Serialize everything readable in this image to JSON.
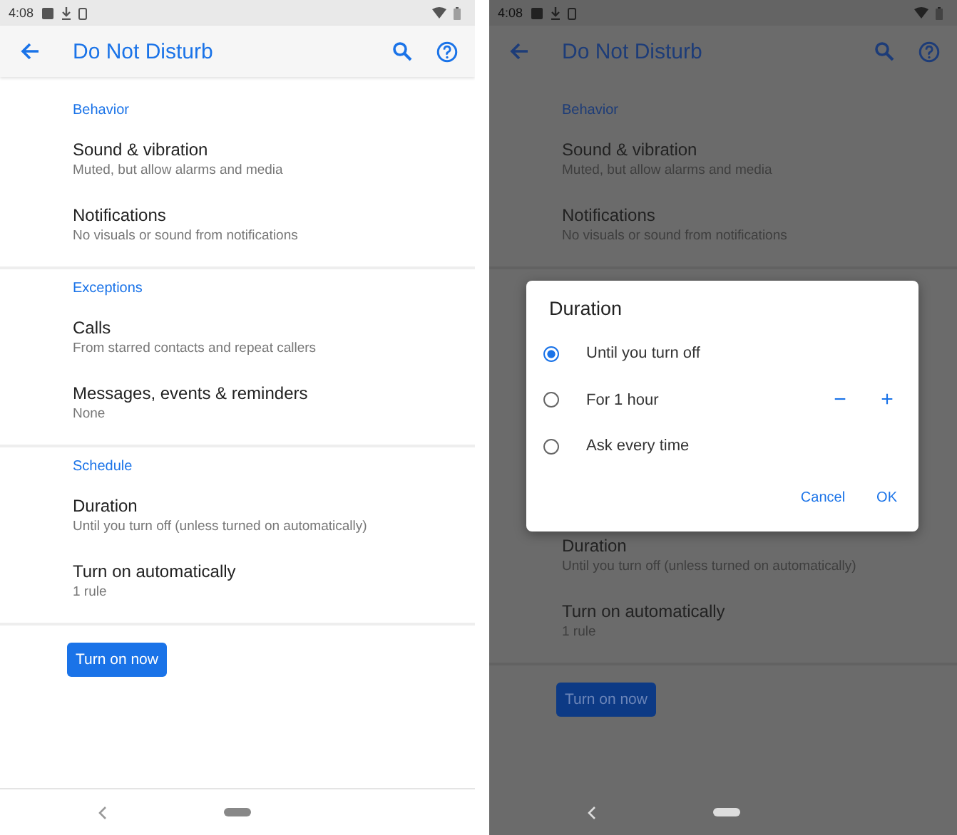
{
  "screens": [
    {
      "dimmed": false,
      "status_bar": {
        "time": "4:08"
      },
      "app_bar": {
        "title": "Do Not Disturb"
      },
      "sections": [
        {
          "header": "Behavior",
          "items": [
            {
              "title": "Sound & vibration",
              "subtitle": "Muted, but allow alarms and media"
            },
            {
              "title": "Notifications",
              "subtitle": "No visuals or sound from notifications"
            }
          ]
        },
        {
          "header": "Exceptions",
          "items": [
            {
              "title": "Calls",
              "subtitle": "From starred contacts and repeat callers"
            },
            {
              "title": "Messages, events & reminders",
              "subtitle": "None"
            }
          ]
        },
        {
          "header": "Schedule",
          "items": [
            {
              "title": "Duration",
              "subtitle": "Until you turn off (unless turned on automatically)"
            },
            {
              "title": "Turn on automatically",
              "subtitle": "1 rule"
            }
          ]
        }
      ],
      "button": "Turn on now"
    },
    {
      "dimmed": true,
      "status_bar": {
        "time": "4:08"
      },
      "app_bar": {
        "title": "Do Not Disturb"
      },
      "sections": [
        {
          "header": "Behavior",
          "items": [
            {
              "title": "Sound & vibration",
              "subtitle": "Muted, but allow alarms and media"
            },
            {
              "title": "Notifications",
              "subtitle": "No visuals or sound from notifications"
            }
          ]
        },
        {
          "items": [
            {
              "title": "Duration",
              "subtitle": "Until you turn off (unless turned on automatically)"
            },
            {
              "title": "Turn on automatically",
              "subtitle": "1 rule"
            }
          ]
        }
      ],
      "button": "Turn on now",
      "dialog": {
        "title": "Duration",
        "options": [
          {
            "label": "Until you turn off",
            "selected": true,
            "stepper": false
          },
          {
            "label": "For 1 hour",
            "selected": false,
            "stepper": true
          },
          {
            "label": "Ask every time",
            "selected": false,
            "stepper": false
          }
        ],
        "stepper": {
          "minus": "−",
          "plus": "+"
        },
        "actions": [
          "Cancel",
          "OK"
        ]
      }
    }
  ]
}
